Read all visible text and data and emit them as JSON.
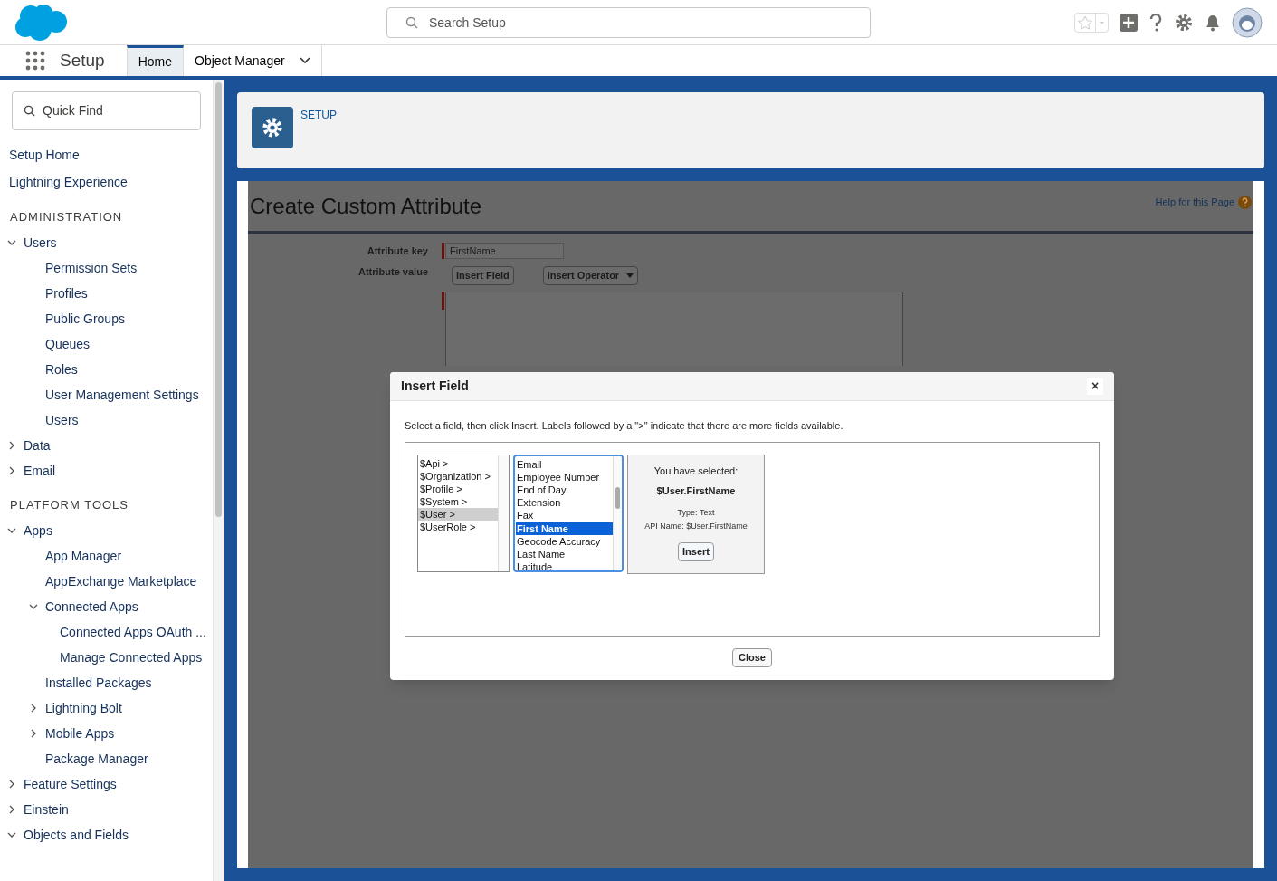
{
  "header": {
    "search": {
      "placeholder": "Search Setup"
    }
  },
  "nav": {
    "app_name": "Setup",
    "tabs": [
      {
        "label": "Home",
        "selected": true,
        "has_menu": false
      },
      {
        "label": "Object Manager",
        "selected": false,
        "has_menu": true
      }
    ]
  },
  "sidebar": {
    "search": {
      "placeholder": "Quick Find"
    },
    "items": [
      {
        "kind": "link",
        "label": "Setup Home"
      },
      {
        "kind": "link",
        "label": "Lightning Experience"
      },
      {
        "kind": "heading",
        "label": "ADMINISTRATION"
      },
      {
        "kind": "node",
        "label": "Users",
        "expanded": true,
        "children": [
          {
            "label": "Permission Sets"
          },
          {
            "label": "Profiles"
          },
          {
            "label": "Public Groups"
          },
          {
            "label": "Queues"
          },
          {
            "label": "Roles"
          },
          {
            "label": "User Management Settings"
          },
          {
            "label": "Users"
          }
        ]
      },
      {
        "kind": "node",
        "label": "Data",
        "expanded": false
      },
      {
        "kind": "node",
        "label": "Email",
        "expanded": false
      },
      {
        "kind": "heading",
        "label": "PLATFORM TOOLS"
      },
      {
        "kind": "node",
        "label": "Apps",
        "expanded": true,
        "children": [
          {
            "label": "App Manager"
          },
          {
            "label": "AppExchange Marketplace"
          },
          {
            "label": "Connected Apps",
            "expanded": true,
            "children": [
              {
                "label": "Connected Apps OAuth ..."
              },
              {
                "label": "Manage Connected Apps"
              }
            ]
          },
          {
            "label": "Installed Packages"
          },
          {
            "label": "Lightning Bolt",
            "expanded": false
          },
          {
            "label": "Mobile Apps",
            "expanded": false
          },
          {
            "label": "Package Manager"
          }
        ]
      },
      {
        "kind": "node",
        "label": "Feature Settings",
        "expanded": false
      },
      {
        "kind": "node",
        "label": "Einstein",
        "expanded": false
      },
      {
        "kind": "node",
        "label": "Objects and Fields",
        "expanded": true
      }
    ]
  },
  "setup_header": {
    "label": "SETUP"
  },
  "page": {
    "title": "Create Custom Attribute",
    "help_link": "Help for this Page",
    "form": {
      "key_label": "Attribute key",
      "key_value": "FirstName",
      "value_label": "Attribute value",
      "buttons": [
        "Insert Field",
        "Insert Operator"
      ]
    }
  },
  "dialog": {
    "title": "Insert Field",
    "close": "×",
    "instructions": "Select a field, then click Insert. Labels followed by a \">\" indicate that there are more fields available.",
    "categories": [
      {
        "label": "$Api >",
        "selected": false
      },
      {
        "label": "$Organization >",
        "selected": false
      },
      {
        "label": "$Profile >",
        "selected": false
      },
      {
        "label": "$System >",
        "selected": false
      },
      {
        "label": "$User >",
        "selected": true
      },
      {
        "label": "$UserRole >",
        "selected": false
      }
    ],
    "fields": [
      {
        "label": "Email",
        "selected": false
      },
      {
        "label": "Employee Number",
        "selected": false
      },
      {
        "label": "End of Day",
        "selected": false
      },
      {
        "label": "Extension",
        "selected": false
      },
      {
        "label": "Fax",
        "selected": false
      },
      {
        "label": "First Name",
        "selected": true
      },
      {
        "label": "Geocode Accuracy",
        "selected": false
      },
      {
        "label": "Last Name",
        "selected": false
      },
      {
        "label": "Latitude",
        "selected": false
      }
    ],
    "selection": {
      "heading": "You have selected:",
      "value": "$User.FirstName",
      "type": "Type: Text",
      "api_name": "API Name: $User.FirstName",
      "button": "Insert"
    },
    "close_button": "Close"
  }
}
